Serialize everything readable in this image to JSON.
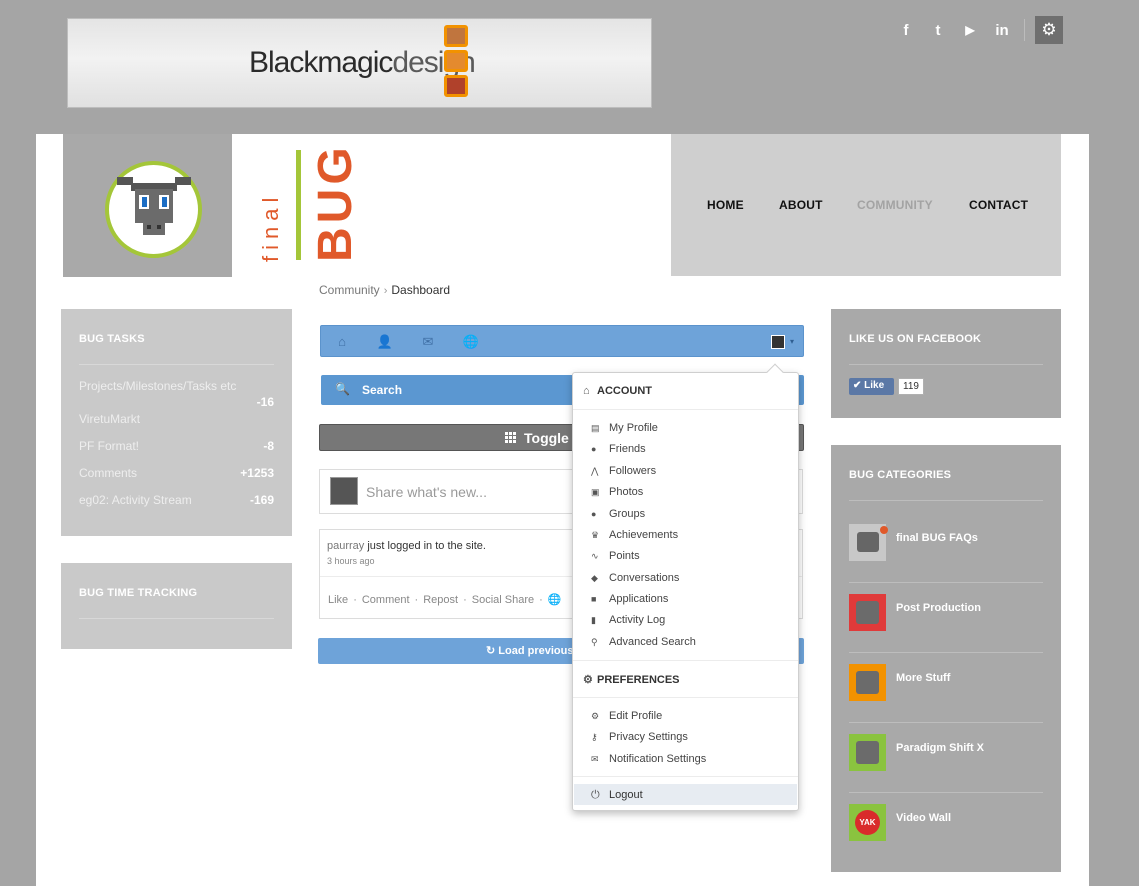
{
  "banner": {
    "brand_bold": "Blackmagic",
    "brand_light": "design"
  },
  "social": {
    "icons": [
      "facebook-icon",
      "twitter-icon",
      "youtube-icon",
      "linkedin-icon"
    ],
    "glyphs": [
      "f",
      "t",
      "▶",
      "in"
    ],
    "gear": "⚙"
  },
  "logo": {
    "final": "final",
    "bug": "BUG"
  },
  "nav": {
    "home": "HOME",
    "about": "ABOUT",
    "community": "COMMUNITY",
    "contact": "CONTACT"
  },
  "breadcrumb": {
    "parent": "Community",
    "current": "Dashboard",
    "sep": "›"
  },
  "left": {
    "tasks_title": "BUG TASKS",
    "tasks": [
      {
        "label": "Projects/Milestones/Tasks etc",
        "value": "-16"
      },
      {
        "label": "ViretuMarkt",
        "value": ""
      },
      {
        "label": "PF Format!",
        "value": "-8"
      },
      {
        "label": "Comments",
        "value": "+1253"
      },
      {
        "label": "eg02: Activity Stream",
        "value": "-169"
      }
    ],
    "time_title": "BUG TIME TRACKING"
  },
  "toolbar": {
    "icons": [
      "⌂",
      "👤",
      "✉",
      "🌐"
    ],
    "caret": "▾"
  },
  "search": {
    "icon": "🔍",
    "label": "Search"
  },
  "toggle": {
    "label": "Toggle"
  },
  "share": {
    "placeholder": "Share what's new..."
  },
  "stream": {
    "user": "paurray",
    "text": " just logged in to the site.",
    "time": "3 hours ago",
    "actions": [
      "Like",
      "Comment",
      "Repost",
      "Social Share"
    ],
    "dot": "·",
    "globe": "🌐"
  },
  "load": {
    "label": "↻  Load previous"
  },
  "dropdown": {
    "account_title": "ACCOUNT",
    "account_items": [
      {
        "label": "My Profile",
        "icon": "▤"
      },
      {
        "label": "Friends",
        "icon": "●"
      },
      {
        "label": "Followers",
        "icon": "⋀"
      },
      {
        "label": "Photos",
        "icon": "▣"
      },
      {
        "label": "Groups",
        "icon": "●"
      },
      {
        "label": "Achievements",
        "icon": "♛"
      },
      {
        "label": "Points",
        "icon": "∿"
      },
      {
        "label": "Conversations",
        "icon": "◆"
      },
      {
        "label": "Applications",
        "icon": "■"
      },
      {
        "label": "Activity Log",
        "icon": "▮"
      },
      {
        "label": "Advanced Search",
        "icon": "⚲"
      }
    ],
    "prefs_title": "PREFERENCES",
    "prefs_items": [
      {
        "label": "Edit Profile",
        "icon": "⚙"
      },
      {
        "label": "Privacy Settings",
        "icon": "⚷"
      },
      {
        "label": "Notification Settings",
        "icon": "✉"
      }
    ],
    "logout": "Logout",
    "logout_icon": "⏻",
    "home_icon": "⌂",
    "gear_icon": "⚙"
  },
  "right": {
    "fb_title": "LIKE US ON FACEBOOK",
    "fb_like": "✔ Like",
    "fb_count": "119",
    "cat_title": "BUG CATEGORIES",
    "categories": [
      {
        "name": "final BUG FAQs",
        "color": "#ffffff"
      },
      {
        "name": "Post Production",
        "color": "#e03a3a"
      },
      {
        "name": "More Stuff",
        "color": "#f29200"
      },
      {
        "name": "Paradigm Shift X",
        "color": "#8ac33f"
      },
      {
        "name": "Video Wall",
        "color": "#8ac33f"
      }
    ],
    "yak": "YAK"
  },
  "colors": {
    "accent": "#6ea3d9",
    "brand_orange": "#e0592a",
    "brand_green": "#a4c639"
  }
}
